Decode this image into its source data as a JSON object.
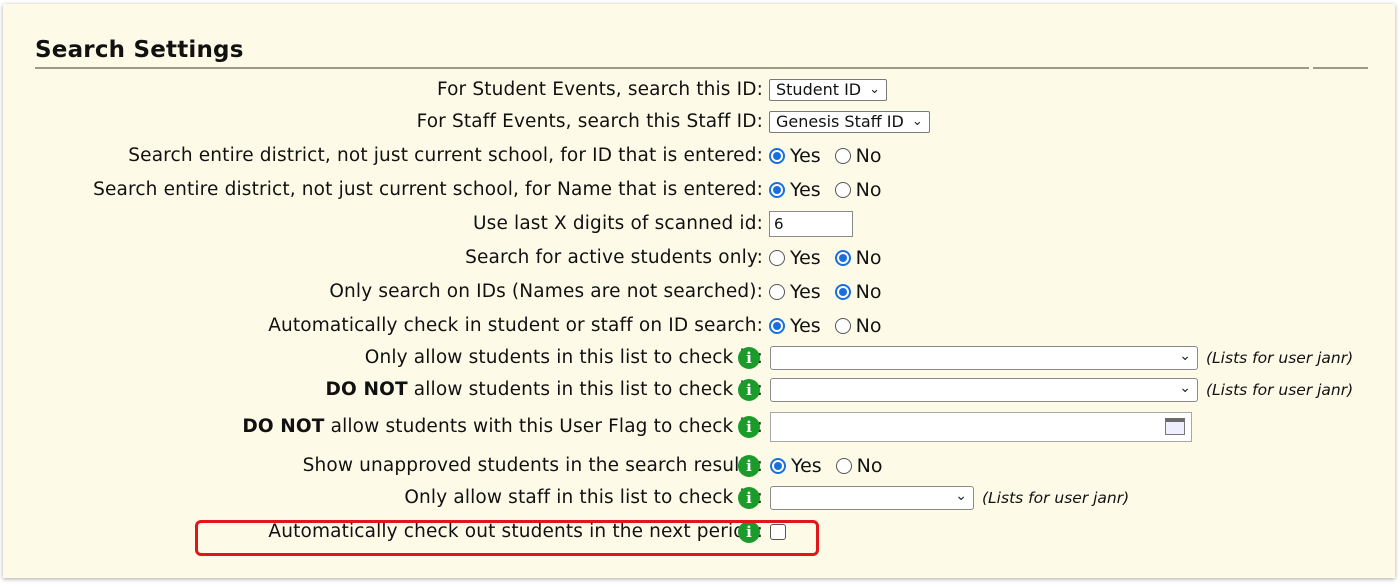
{
  "section_title": "Search Settings",
  "rows": {
    "student_id": {
      "label": "For Student Events, search this ID:",
      "value": "Student ID"
    },
    "staff_id": {
      "label": "For Staff Events, search this Staff ID:",
      "value": "Genesis Staff ID"
    },
    "district_id": {
      "label": "Search entire district, not just current school, for ID that is entered:",
      "yes": "Yes",
      "no": "No",
      "selected": "Yes"
    },
    "district_name": {
      "label": "Search entire district, not just current school, for Name that is entered:",
      "yes": "Yes",
      "no": "No",
      "selected": "Yes"
    },
    "last_digits": {
      "label": "Use last X digits of scanned id:",
      "value": "6"
    },
    "active_only": {
      "label": "Search for active students only:",
      "yes": "Yes",
      "no": "No",
      "selected": "No"
    },
    "ids_only": {
      "label": "Only search on IDs (Names are not searched):",
      "yes": "Yes",
      "no": "No",
      "selected": "No"
    },
    "auto_checkin": {
      "label": "Automatically check in student or staff on ID search:",
      "yes": "Yes",
      "no": "No",
      "selected": "Yes"
    },
    "allow_list": {
      "label": "Only allow students in this list to check in:",
      "value": "",
      "hint": "(Lists for user janr)"
    },
    "deny_list": {
      "label_bold": "DO NOT",
      "label_rest": " allow students in this list to check in:",
      "value": "",
      "hint": "(Lists for user janr)"
    },
    "deny_flag": {
      "label_bold": "DO NOT",
      "label_rest": " allow students with this User Flag to check in:",
      "value": ""
    },
    "unapproved": {
      "label": "Show unapproved students in the search results:",
      "yes": "Yes",
      "no": "No",
      "selected": "Yes"
    },
    "staff_list": {
      "label": "Only allow staff in this list to check in:",
      "value": "",
      "hint": "(Lists for user janr)"
    },
    "auto_checkout": {
      "label": "Automatically check out students in the next period:",
      "checked": false
    }
  },
  "icons": {
    "info": "info-icon",
    "calendar": "calendar-icon",
    "chevron": "chevron-down-icon"
  },
  "colors": {
    "info_green": "#1b9c2a",
    "radio_blue": "#1a6fdf",
    "highlight_red": "#e0161b",
    "panel_bg": "#fdfbe8"
  }
}
